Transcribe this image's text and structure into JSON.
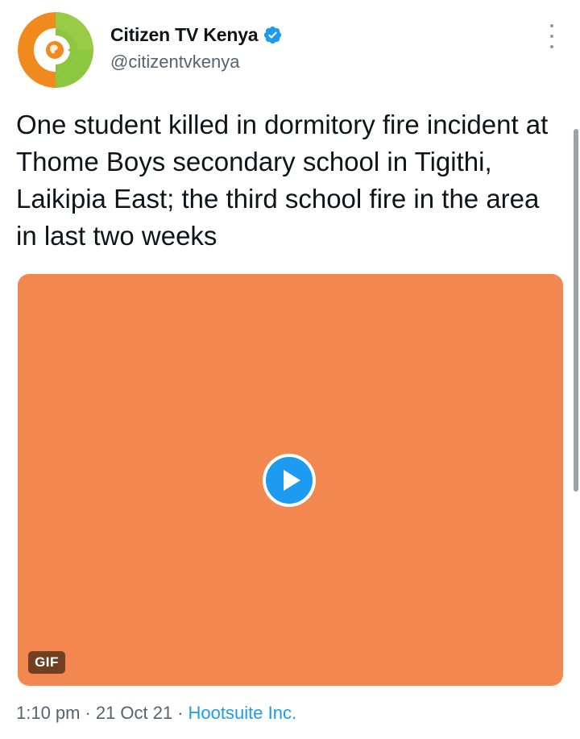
{
  "author": {
    "display_name": "Citizen TV Kenya",
    "handle": "@citizentvkenya",
    "verified": true,
    "avatar_icon": "citizen-tv-logo-icon"
  },
  "tweet": {
    "text": "One student killed in dormitory fire incident at Thome Boys secondary school in Tigithi, Laikipia East; the third school fire in the area in last two weeks"
  },
  "media": {
    "type": "gif",
    "badge": "GIF",
    "background_color": "#f2874f",
    "play_icon": "play-icon"
  },
  "meta": {
    "time": "1:10 pm",
    "date": "21 Oct 21",
    "separator": "·",
    "source": "Hootsuite Inc."
  },
  "colors": {
    "link_blue": "#1d9bf0",
    "secondary_text": "#536471",
    "avatar_orange": "#f08a1d",
    "avatar_green": "#8dc63f"
  }
}
